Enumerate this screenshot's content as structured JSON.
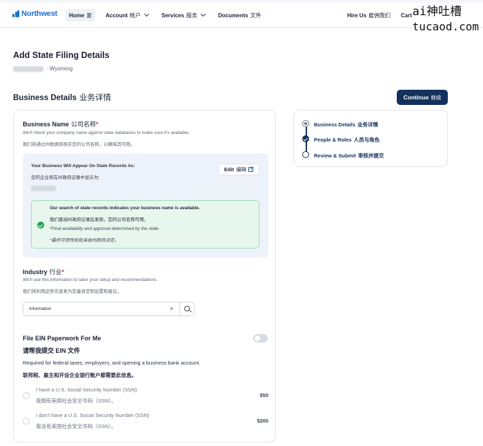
{
  "nav": {
    "logo": "Northwest",
    "home": {
      "en": "Home",
      "zh": "家"
    },
    "account": {
      "en": "Account",
      "zh": "帐户"
    },
    "services": {
      "en": "Services",
      "zh": "服务"
    },
    "documents": {
      "en": "Documents",
      "zh": "文件"
    },
    "hire_us": {
      "en": "Hire Us",
      "zh": "雇佣我们"
    },
    "cart": "Cart"
  },
  "watermark": {
    "line1": "ai神吐槽",
    "line2": "tucaod.com"
  },
  "header": {
    "title": "Add State Filing Details",
    "state": "· Wyoming"
  },
  "section": {
    "title": "Business Details",
    "title_zh": "业务详情"
  },
  "continue_button": {
    "en": "Continue",
    "zh": "继续"
  },
  "business_name": {
    "label": "Business Name",
    "label_zh": "公司名称",
    "required": "*",
    "desc": "We'll check your company name against state databases to make sure it's available.",
    "desc_zh": "我们将通过州数据库核实您的公司名称，以确保其可用。",
    "record_title": "Your Business Will Appear On State Records As:",
    "record_title_zh": "您的企业将在州政府记录中显示为:",
    "edit": "Edit",
    "edit_zh": "编辑",
    "success_1": "Our search of state records indicates your business name is available.",
    "success_2": "我们查阅州政府记录后发现，您的公司名称可用。",
    "success_3": "*Final availability and approval determined by the state.",
    "success_4": "*最终可用性和批准由州政府决定。"
  },
  "industry": {
    "label": "Industry",
    "label_zh": "行业",
    "required": "*",
    "desc": "We'll use this information to tailor your setup and recommendations.",
    "desc_zh": "我们将利用这些信息来为您量身定制设置和建议。",
    "value": "Information",
    "clear": "×"
  },
  "ein": {
    "label": "File EIN Paperwork For Me",
    "label_zh": "请帮我提交 EIN 文件",
    "desc": "Required for federal taxes, employers, and opening a business bank account.",
    "desc_zh": "联邦税、雇主和开设企业银行账户都需要此信息。",
    "toggle_on": false,
    "options": [
      {
        "en": "I have a U.S. Social Security Number (SSN)",
        "zh": "我拥有美国社会安全号码（SSN）。",
        "price": "$50"
      },
      {
        "en": "I don't have a U.S. Social Security Number (SSN)",
        "zh": "我没有美国社会安全号码（SSN）。",
        "price": "$200"
      }
    ]
  },
  "stepper": [
    {
      "en": "Business Details",
      "zh": "业务详情",
      "state": "current"
    },
    {
      "en": "People & Roles",
      "zh": "人员与角色",
      "state": "done"
    },
    {
      "en": "Review & Submit",
      "zh": "审核并提交",
      "state": "todo"
    }
  ]
}
